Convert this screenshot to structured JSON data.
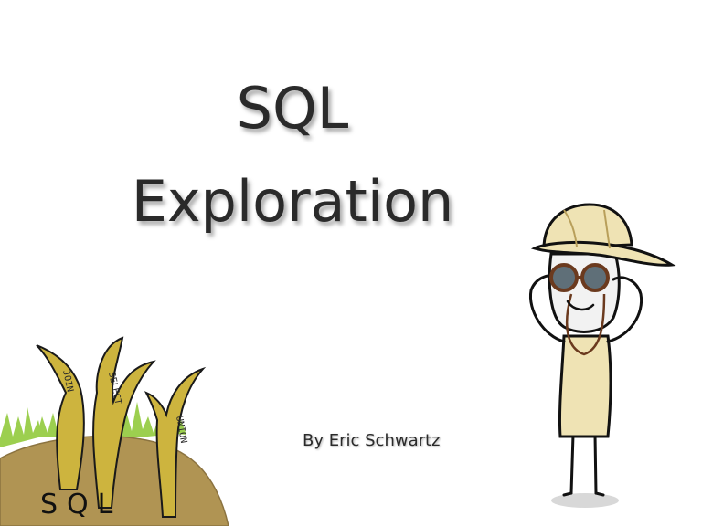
{
  "slide": {
    "title_line1": "SQL",
    "title_line2": "Exploration",
    "byline": "By Eric Schwartz"
  },
  "garden": {
    "mound_label": "SQL",
    "blades": [
      {
        "label": "JOIN"
      },
      {
        "label": "SELECT"
      },
      {
        "label": "UNION"
      }
    ]
  },
  "colors": {
    "text": "#2a2a2a",
    "dirt": "#b09453",
    "grass": "#9ccf4f",
    "blade": "#cdb43e",
    "skin": "#f2f2f2",
    "body": "#efe3b4",
    "hat": "#efe3b4",
    "lens": "#5f6f78",
    "frame": "#6b3a1e"
  }
}
